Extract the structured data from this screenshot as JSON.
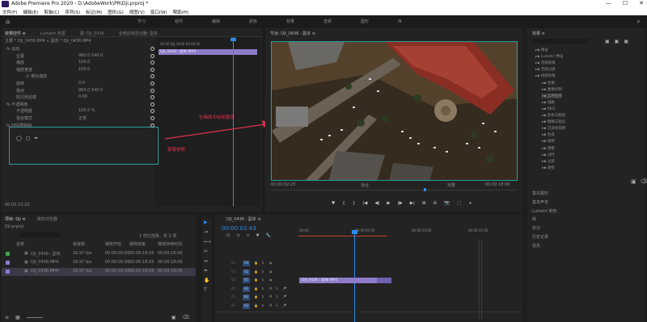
{
  "titlebar": {
    "title": "Adobe Premiere Pro 2020 - D:\\AdobeWork\\PR\\Dji.prproj *",
    "min": "—",
    "max": "☐",
    "close": "✕"
  },
  "menu": [
    "文件(F)",
    "编辑(E)",
    "剪辑(C)",
    "序列(S)",
    "标记(M)",
    "图形(G)",
    "视图(V)",
    "窗口(W)",
    "帮助(H)"
  ],
  "workspaces": [
    "学习",
    "组件",
    "编辑",
    "颜色",
    "效果",
    "音频",
    "图形",
    "库"
  ],
  "effect_controls": {
    "tabs": [
      "效果控件 ≡",
      "Lumetri 范围",
      "源: DJI_0436",
      "音频剪辑混合器: 副本"
    ],
    "source_line": "主要 * DJI_0436.MP4 ∨ 副本 * DJI_0436.MP4",
    "mini_timecode": "00:00 DJI_0436 00:00:05",
    "clip_bar": "DJI_0436 : 副本.MP4",
    "sections": [
      {
        "label": "fx 运动",
        "indent": 0,
        "value": ""
      },
      {
        "label": "位置",
        "indent": 1,
        "value": "960.0  540.0"
      },
      {
        "label": "缩放",
        "indent": 1,
        "value": "100.0"
      },
      {
        "label": "缩放宽度",
        "indent": 1,
        "value": "100.0"
      },
      {
        "label": "☑ 等比缩放",
        "indent": 2,
        "value": ""
      },
      {
        "label": "旋转",
        "indent": 1,
        "value": "0.0"
      },
      {
        "label": "锚点",
        "indent": 1,
        "value": "960.0  540.0"
      },
      {
        "label": "防闪烁滤镜",
        "indent": 1,
        "value": "0.00"
      },
      {
        "label": "fx 不透明度",
        "indent": 0,
        "value": ""
      },
      {
        "label": "不透明度",
        "indent": 1,
        "value": "100.0 %"
      },
      {
        "label": "混合模式",
        "indent": 1,
        "value": "正常"
      },
      {
        "label": "fx 时间重映射",
        "indent": 0,
        "value": ""
      }
    ],
    "annotation_label": "蒙版参数",
    "highlight_time": "00:00:15:25"
  },
  "annotation_arrow_text": "在画面中绘制蒙版",
  "program": {
    "title": "节目: DJI_0436 : 副本 ≡",
    "timecode_left": "00:00:02:25",
    "fit": "适合",
    "quality": "完整",
    "timecode_right": "00:00:18:06",
    "controls": [
      "▼",
      "{",
      "}",
      "|◀",
      "◀|",
      "▶",
      "|▶",
      "▶|",
      "⊞",
      "⊟",
      "📷",
      "⬚",
      "+"
    ]
  },
  "effects_panel": {
    "title": "效果 ≡",
    "items": [
      {
        "label": "预设",
        "indent": 0
      },
      {
        "label": "Lumetri 预设",
        "indent": 0
      },
      {
        "label": "音频效果",
        "indent": 0
      },
      {
        "label": "音频过渡",
        "indent": 0
      },
      {
        "label": "视频效果",
        "indent": 0
      },
      {
        "label": "变换",
        "indent": 1
      },
      {
        "label": "图像控制",
        "indent": 1
      },
      {
        "label": "实用程序",
        "indent": 1
      },
      {
        "label": "扭曲",
        "indent": 1
      },
      {
        "label": "时间",
        "indent": 1
      },
      {
        "label": "杂色与颗粒",
        "indent": 1
      },
      {
        "label": "模糊与锐化",
        "indent": 1
      },
      {
        "label": "沉浸式视频",
        "indent": 1
      },
      {
        "label": "生成",
        "indent": 1
      },
      {
        "label": "视频",
        "indent": 1
      },
      {
        "label": "调整",
        "indent": 1
      },
      {
        "label": "过时",
        "indent": 1
      },
      {
        "label": "过渡",
        "indent": 1
      },
      {
        "label": "透视",
        "indent": 1
      }
    ],
    "side_panels": [
      "基本图形",
      "基本声音",
      "Lumetri 颜色",
      "库",
      "标记",
      "历史记录",
      "信息"
    ]
  },
  "project": {
    "tabs": [
      "项目: Dji ≡",
      "媒体浏览器"
    ],
    "path": "Dji.prproj",
    "count": "1 项已选择，共 3 项",
    "columns": [
      "名称",
      "帧速率",
      "媒体开始",
      "媒体结束",
      "媒体持续时间"
    ],
    "rows": [
      {
        "color": "#3fa34a",
        "name": "DJI_0436 : 副本",
        "rate": "29.97 fps",
        "start": "00:00:00:00",
        "end": "00:00:18:05",
        "dur": "00:00:18:06"
      },
      {
        "color": "#8f78d6",
        "name": "DJI_0436.MP4",
        "rate": "29.97 fps",
        "start": "00:00:00:00",
        "end": "00:00:18:05",
        "dur": "00:00:18:06"
      },
      {
        "color": "#8f78d6",
        "name": "DJI_0436.MP4",
        "rate": "29.97 fps",
        "start": "00:00:00:00",
        "end": "00:00:18:05",
        "dur": "00:00:18:06"
      }
    ]
  },
  "timeline": {
    "tab": "DJI_0436 : 副本 ≡",
    "timecode": "00:00:02:43",
    "ruler": [
      ":00:00",
      "00:00:05:00",
      "00:00:10:00",
      "00:00:15:00"
    ],
    "clip": "DJI_0436 : 副本.MP4",
    "tracks": [
      {
        "name": "V3",
        "type": "video"
      },
      {
        "name": "V2",
        "type": "video"
      },
      {
        "name": "V1",
        "type": "video"
      },
      {
        "name": "A1",
        "type": "audio"
      },
      {
        "name": "A2",
        "type": "audio"
      },
      {
        "name": "A3",
        "type": "audio"
      }
    ]
  },
  "colors": {
    "accent_blue": "#2d8ceb",
    "annotation_teal": "#2b9d9b",
    "annotation_red": "#e0304a",
    "clip_purple": "#8e7cc9"
  }
}
